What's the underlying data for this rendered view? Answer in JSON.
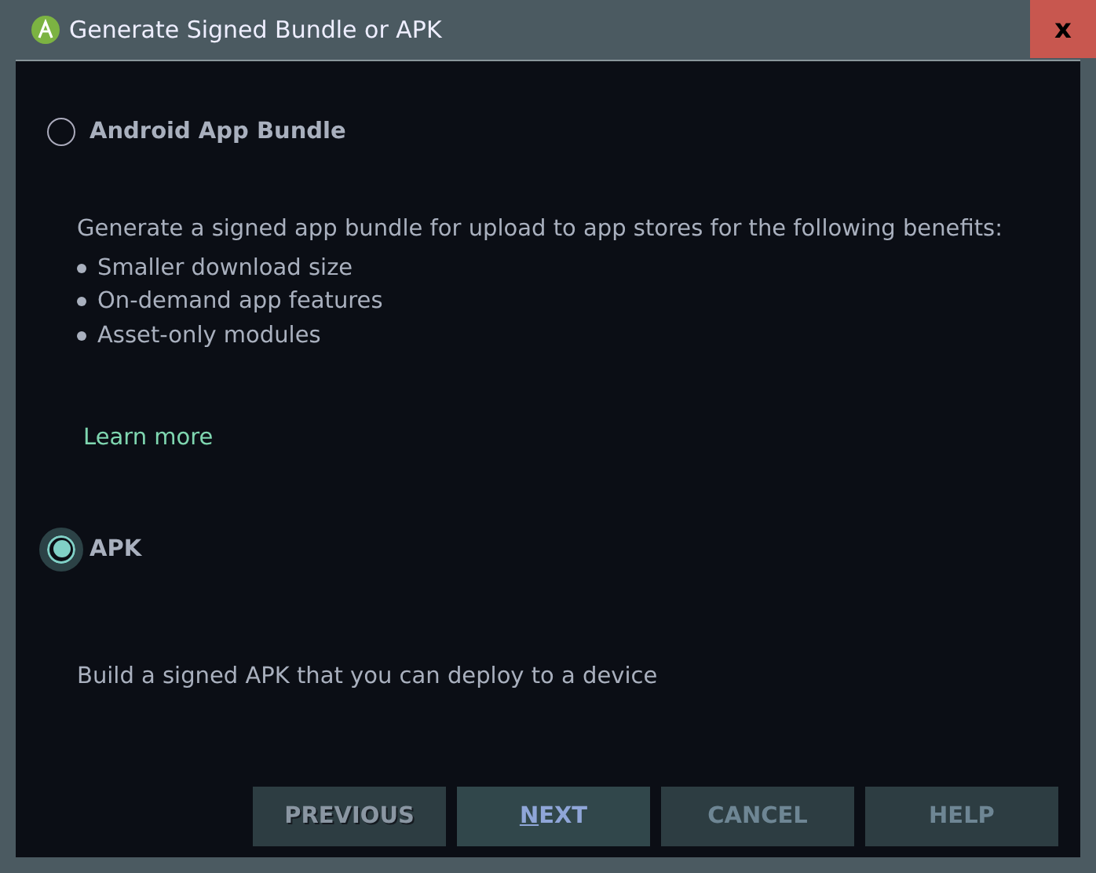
{
  "window": {
    "title": "Generate Signed Bundle or APK",
    "close": "x"
  },
  "options": [
    {
      "label": "Android App Bundle",
      "selected": false,
      "description": "Generate a signed app bundle for upload to app stores for the following benefits:",
      "bullets": [
        "Smaller download size",
        "On-demand app features",
        "Asset-only modules"
      ],
      "link": "Learn more"
    },
    {
      "label": "APK",
      "selected": true,
      "description": "Build a signed APK that you can deploy to a device"
    }
  ],
  "buttons": [
    {
      "label": "PREVIOUS",
      "disabled": true,
      "focused": false,
      "mnemonic": false
    },
    {
      "label": "NEXT",
      "disabled": false,
      "focused": true,
      "mnemonic": true
    },
    {
      "label": "CANCEL",
      "disabled": false,
      "focused": false,
      "mnemonic": false
    },
    {
      "label": "HELP",
      "disabled": false,
      "focused": false,
      "mnemonic": false
    }
  ]
}
